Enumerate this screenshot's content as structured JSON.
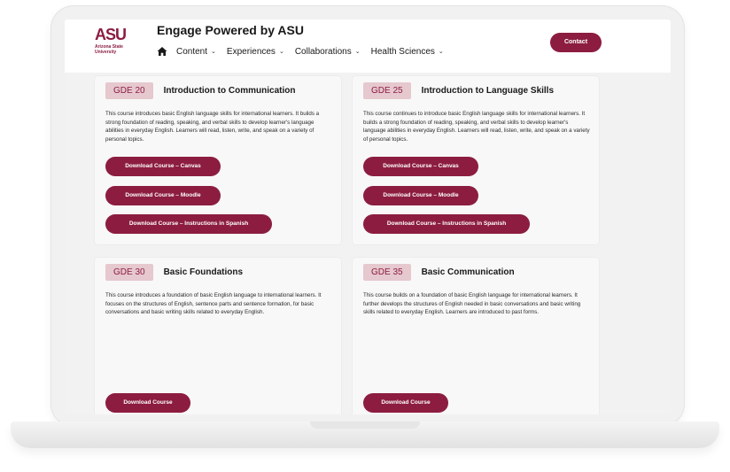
{
  "header": {
    "logo_mark": "ASU",
    "logo_sub_line1": "Arizona State",
    "logo_sub_line2": "University",
    "site_title": "Engage Powered by ASU",
    "nav": [
      {
        "label": "Content"
      },
      {
        "label": "Experiences"
      },
      {
        "label": "Collaborations"
      },
      {
        "label": "Health Sciences"
      }
    ],
    "contact_label": "Contact"
  },
  "colors": {
    "brand_maroon": "#8c1d40",
    "badge_bg": "#e6c8cf"
  },
  "icons": {
    "home": "home-icon",
    "dropdown": "chevron-down-icon"
  },
  "cards": [
    {
      "code": "GDE 20",
      "title": "Introduction to Communication",
      "desc": "This course introduces basic English language skills for international learners. It builds a strong foundation of reading, speaking, and verbal skills to develop learner's language abilities in everyday English. Learners will read, listen, write, and speak on a variety of personal topics.",
      "buttons": [
        "Download Course – Canvas",
        "Download Course – Moodle",
        "Download Course – Instructions in Spanish"
      ]
    },
    {
      "code": "GDE 25",
      "title": "Introduction to Language Skills",
      "desc": "This course continues to introduce basic English language skills for international learners. It builds a strong foundation of reading, speaking, and verbal skills to develop learner's language abilities in everyday English. Learners will read, listen, write, and speak on a variety of personal topics.",
      "buttons": [
        "Download Course – Canvas",
        "Download Course – Moodle",
        "Download Course – Instructions in Spanish"
      ]
    },
    {
      "code": "GDE 30",
      "title": "Basic Foundations",
      "desc": "This course introduces a foundation of basic English language to international learners. It focuses on the structures of English, sentence parts and sentence formation, for basic conversations and basic writing skills related to everyday English.",
      "buttons": [
        "Download Course"
      ]
    },
    {
      "code": "GDE 35",
      "title": "Basic Communication",
      "desc": "This course builds on a foundation of basic English language for international learners. It further develops the structures of English needed in basic conversations and basic writing skills related to everyday English. Learners are introduced to past forms.",
      "buttons": [
        "Download Course"
      ]
    }
  ]
}
